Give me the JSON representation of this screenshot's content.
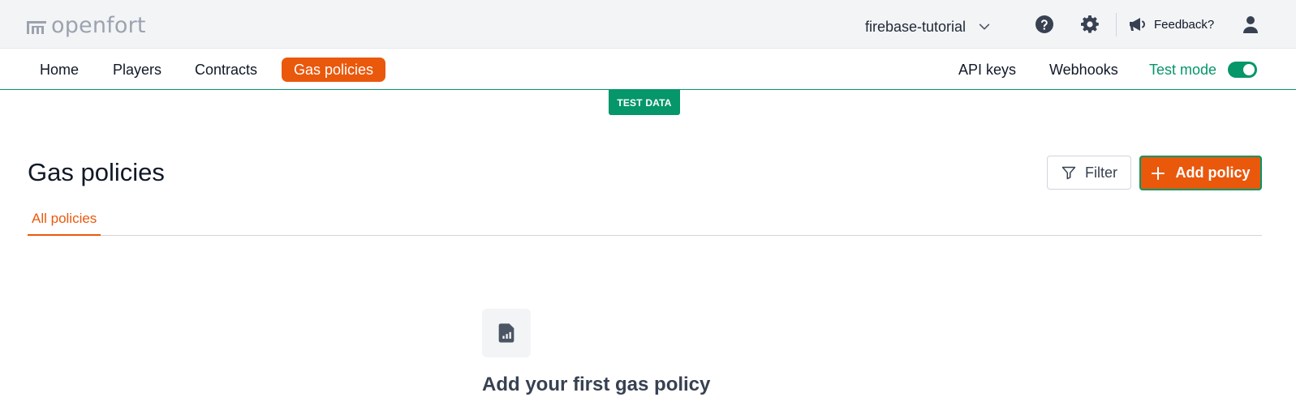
{
  "brand": {
    "name": "openfort",
    "logo_icon": "openfort-logo-icon"
  },
  "header": {
    "project_name": "firebase-tutorial",
    "project_chevron_icon": "chevron-down-icon",
    "help_icon": "help-icon",
    "settings_icon": "gear-icon",
    "feedback_label": "Feedback?",
    "feedback_icon": "megaphone-icon",
    "user_icon": "user-icon"
  },
  "nav": {
    "items": [
      {
        "label": "Home",
        "active": false
      },
      {
        "label": "Players",
        "active": false
      },
      {
        "label": "Contracts",
        "active": false
      },
      {
        "label": "Gas policies",
        "active": true
      }
    ],
    "right": [
      {
        "label": "API keys"
      },
      {
        "label": "Webhooks"
      }
    ],
    "test_mode": {
      "label": "Test mode",
      "enabled": true
    }
  },
  "badge": {
    "label": "TEST DATA"
  },
  "page": {
    "title": "Gas policies",
    "filter_label": "Filter",
    "add_label": "Add policy",
    "tabs": [
      {
        "label": "All policies",
        "active": true
      }
    ]
  },
  "empty_state": {
    "icon": "document-chart-icon",
    "title": "Add your first gas policy"
  },
  "colors": {
    "accent": "#ea580c",
    "test_mode": "#059669",
    "topbar_bg": "#f3f4f6"
  }
}
